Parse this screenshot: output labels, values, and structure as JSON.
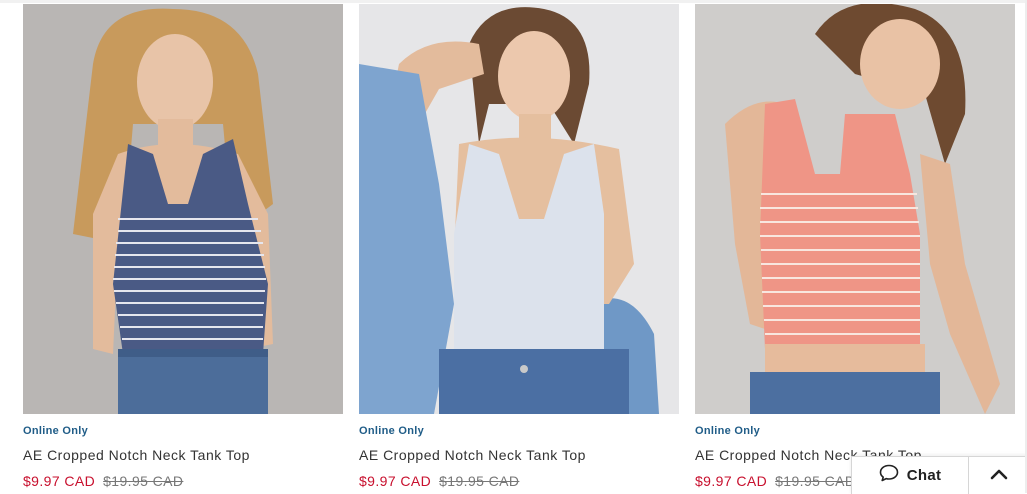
{
  "products": [
    {
      "badge": "Online Only",
      "title": "AE Cropped Notch Neck Tank Top",
      "sale_price": "$9.97 CAD",
      "original_price": "$19.95 CAD",
      "image_alt": "Model wearing navy and white striped notch neck tank top with jeans"
    },
    {
      "badge": "Online Only",
      "title": "AE Cropped Notch Neck Tank Top",
      "sale_price": "$9.97 CAD",
      "original_price": "$19.95 CAD",
      "image_alt": "Model wearing light blue notch neck tank top with denim jacket"
    },
    {
      "badge": "Online Only",
      "title": "AE Cropped Notch Neck Tank Top",
      "sale_price": "$9.97 CAD",
      "original_price": "$19.95 CAD",
      "image_alt": "Model wearing coral and white striped notch neck tank top"
    }
  ],
  "chat_widget": {
    "label": "Chat",
    "chat_icon": "speech-bubble-icon",
    "top_icon": "chevron-up-icon"
  },
  "colors": {
    "sale": "#c8102e",
    "badge": "#1f5c87",
    "text": "#333333"
  }
}
